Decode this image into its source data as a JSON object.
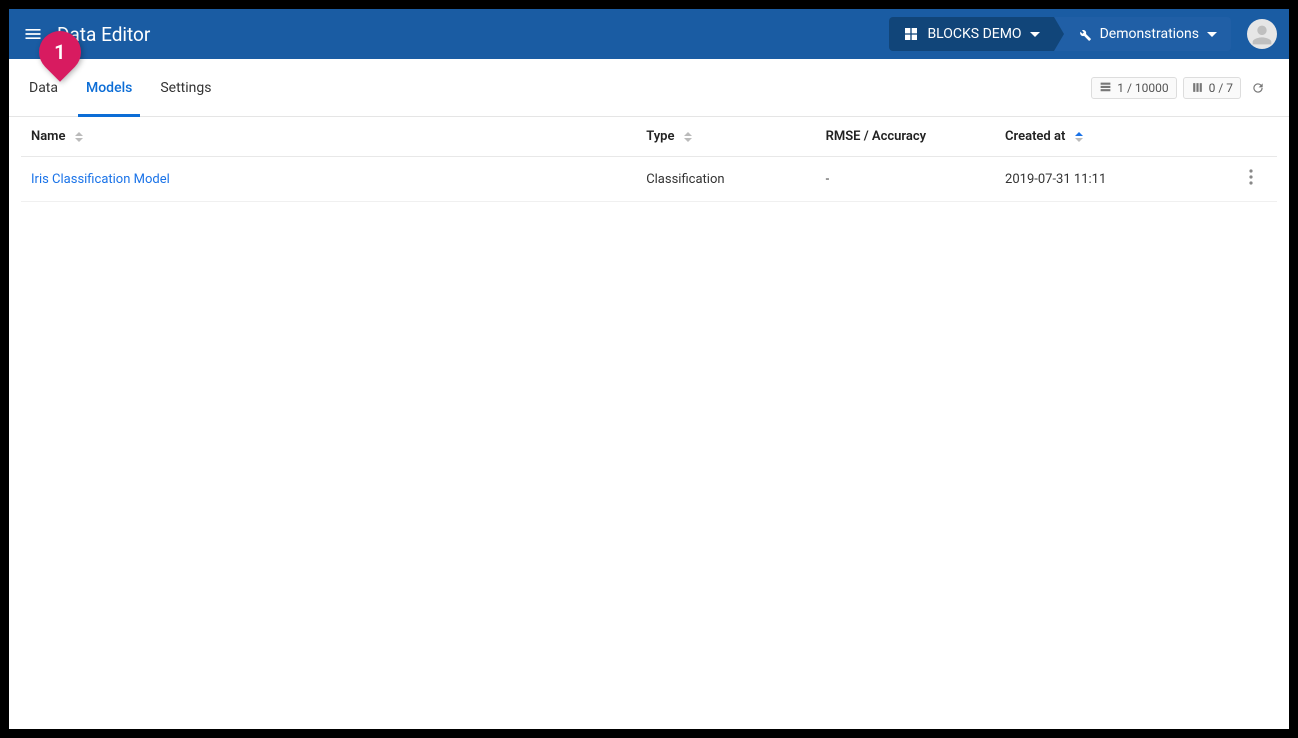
{
  "header": {
    "appTitle": "Data Editor",
    "breadcrumb": {
      "project": "BLOCKS DEMO",
      "section": "Demonstrations"
    }
  },
  "annotation": {
    "marker": "1"
  },
  "tabs": {
    "items": [
      {
        "label": "Data",
        "active": false
      },
      {
        "label": "Models",
        "active": true
      },
      {
        "label": "Settings",
        "active": false
      }
    ]
  },
  "status": {
    "rows": "1 / 10000",
    "cols": "0 / 7"
  },
  "table": {
    "columns": {
      "name": "Name",
      "type": "Type",
      "rmse": "RMSE / Accuracy",
      "created": "Created at"
    },
    "rows": [
      {
        "name": "Iris Classification Model",
        "type": "Classification",
        "rmse": "-",
        "created": "2019-07-31 11:11"
      }
    ]
  }
}
